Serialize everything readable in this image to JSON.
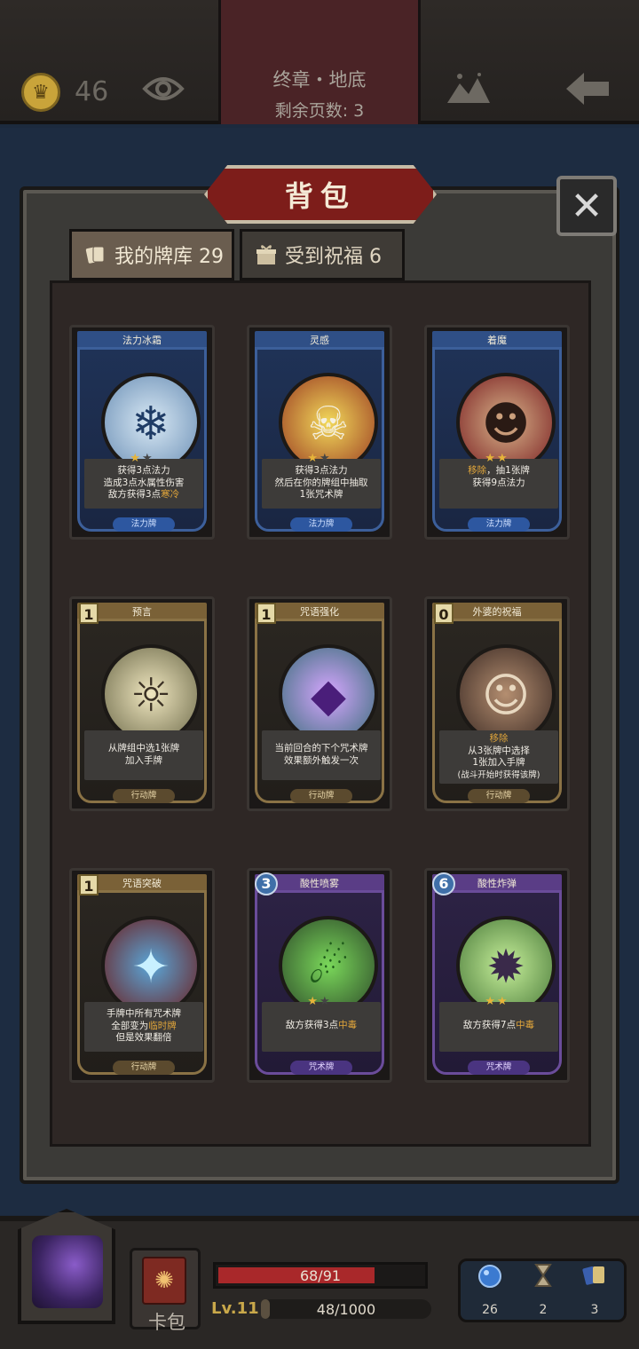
{
  "top": {
    "gold": "46",
    "chapter_title": "终章・地底",
    "pages_left": "剩余页数: 3"
  },
  "panel": {
    "title": "背包",
    "close": "✕",
    "tabs": [
      {
        "label": "我的牌库 29"
      },
      {
        "label": "受到祝福 6"
      }
    ]
  },
  "cards": [
    {
      "name": "法力冰霜",
      "theme": "blue",
      "cost": "",
      "stars": 1,
      "desc": [
        "获得3点法力",
        "造成3点水属性伤害",
        "敌方获得3点"
      ],
      "desc_hl": "寒冷",
      "type": "法力牌"
    },
    {
      "name": "灵感",
      "theme": "blue",
      "cost": "",
      "stars": 1,
      "desc": [
        "获得3点法力",
        "然后在你的牌组中抽取",
        "1张咒术牌"
      ],
      "desc_hl": "",
      "type": "法力牌"
    },
    {
      "name": "着魔",
      "theme": "blue",
      "cost": "",
      "stars": 2,
      "desc_hl_first": "移除",
      "desc": [
        "，抽1张牌",
        "获得9点法力"
      ],
      "type": "法力牌"
    },
    {
      "name": "预言",
      "theme": "gold",
      "cost": "1",
      "stars": 0,
      "desc": [
        "从牌组中选1张牌",
        "加入手牌"
      ],
      "type": "行动牌"
    },
    {
      "name": "咒语强化",
      "theme": "gold",
      "cost": "1",
      "stars": 0,
      "desc": [
        "当前回合的下个咒术牌",
        "效果额外触发一次"
      ],
      "type": "行动牌"
    },
    {
      "name": "外婆的祝福",
      "theme": "gold",
      "cost": "0",
      "stars": 0,
      "desc_hl_first": "移除",
      "desc": [
        "从3张牌中选择",
        "1张加入手牌",
        "(战斗开始时获得该牌)"
      ],
      "type": "行动牌"
    },
    {
      "name": "咒语突破",
      "theme": "gold",
      "cost": "1",
      "stars": 0,
      "desc": [
        "手牌中所有咒术牌",
        "全部变为",
        "但是效果翻倍"
      ],
      "desc_hl": "临时牌",
      "type": "行动牌"
    },
    {
      "name": "酸性喷雾",
      "theme": "purple",
      "cost": "3",
      "stars": 1,
      "desc": [
        "敌方获得3点"
      ],
      "desc_hl": "中毒",
      "type": "咒术牌"
    },
    {
      "name": "酸性炸弹",
      "theme": "purple",
      "cost": "6",
      "stars": 2,
      "desc": [
        "敌方获得7点"
      ],
      "desc_hl": "中毒",
      "type": "咒术牌"
    }
  ],
  "bottom": {
    "cardpack_label": "卡包",
    "hp": "68/91",
    "hp_fraction": 0.747,
    "level": "Lv.11",
    "xp": "48/1000",
    "xp_fraction": 0.048,
    "stats": [
      {
        "icon": "mana-orb-icon",
        "value": "26"
      },
      {
        "icon": "hourglass-icon",
        "value": "2"
      },
      {
        "icon": "cards-icon",
        "value": "3"
      }
    ]
  },
  "colors": {
    "accent_red": "#7d1d1a",
    "gold": "#c9a43a",
    "highlight": "#e0a53a"
  }
}
